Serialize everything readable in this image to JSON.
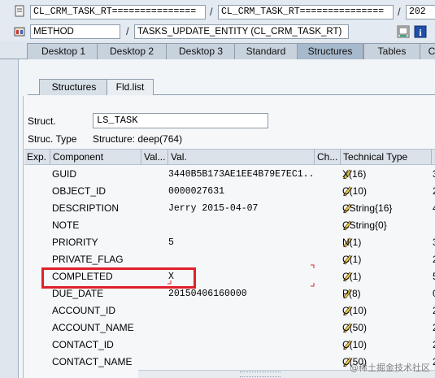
{
  "header": {
    "field1": "CL_CRM_TASK_RT===============",
    "field2": "CL_CRM_TASK_RT===============",
    "field3": "202",
    "method_label": "METHOD",
    "method_value": "TASKS_UPDATE_ENTITY (CL_CRM_TASK_RT)",
    "slash": "/"
  },
  "tabs": [
    "Desktop 1",
    "Desktop 2",
    "Desktop 3",
    "Standard",
    "Structures",
    "Tables",
    "C"
  ],
  "subtabs": [
    "Structures",
    "Fld.list"
  ],
  "struct": {
    "label": "Struct.",
    "value": "LS_TASK",
    "type_label": "Struc. Type",
    "type_value": "Structure: deep(764)"
  },
  "table": {
    "headers": [
      "Exp.",
      "Component",
      "Val...",
      "Val.",
      "Ch...",
      "Technical Type",
      "L"
    ],
    "rows": [
      {
        "component": "GUID",
        "val": "3440B5B173AE1EE4B79E7EC1...",
        "type": "X(16)",
        "len": "3"
      },
      {
        "component": "OBJECT_ID",
        "val": "0000027631",
        "type": "C(10)",
        "len": "2"
      },
      {
        "component": "DESCRIPTION",
        "val": "Jerry 2015-04-07",
        "type": "CString{16}",
        "len": "4"
      },
      {
        "component": "NOTE",
        "val": "",
        "type": "CString{0}",
        "len": ""
      },
      {
        "component": "PRIORITY",
        "val": "5",
        "type": "N(1)",
        "len": "3"
      },
      {
        "component": "PRIVATE_FLAG",
        "val": "",
        "type": "C(1)",
        "len": "2"
      },
      {
        "component": "COMPLETED",
        "val": "X",
        "type": "C(1)",
        "len": "5"
      },
      {
        "component": "DUE_DATE",
        "val": "20150406160000",
        "type": "P(8)",
        "len": "0"
      },
      {
        "component": "ACCOUNT_ID",
        "val": "",
        "type": "C(10)",
        "len": "2"
      },
      {
        "component": "ACCOUNT_NAME",
        "val": "",
        "type": "C(50)",
        "len": "2"
      },
      {
        "component": "CONTACT_ID",
        "val": "",
        "type": "C(10)",
        "len": "2"
      },
      {
        "component": "CONTACT_NAME",
        "val": "",
        "type": "C(50)",
        "len": "2"
      }
    ]
  },
  "watermark": "@稀土掘金技术社区",
  "colors": {
    "highlight": "#e0202a",
    "active_tab": "#a7b9cc"
  }
}
